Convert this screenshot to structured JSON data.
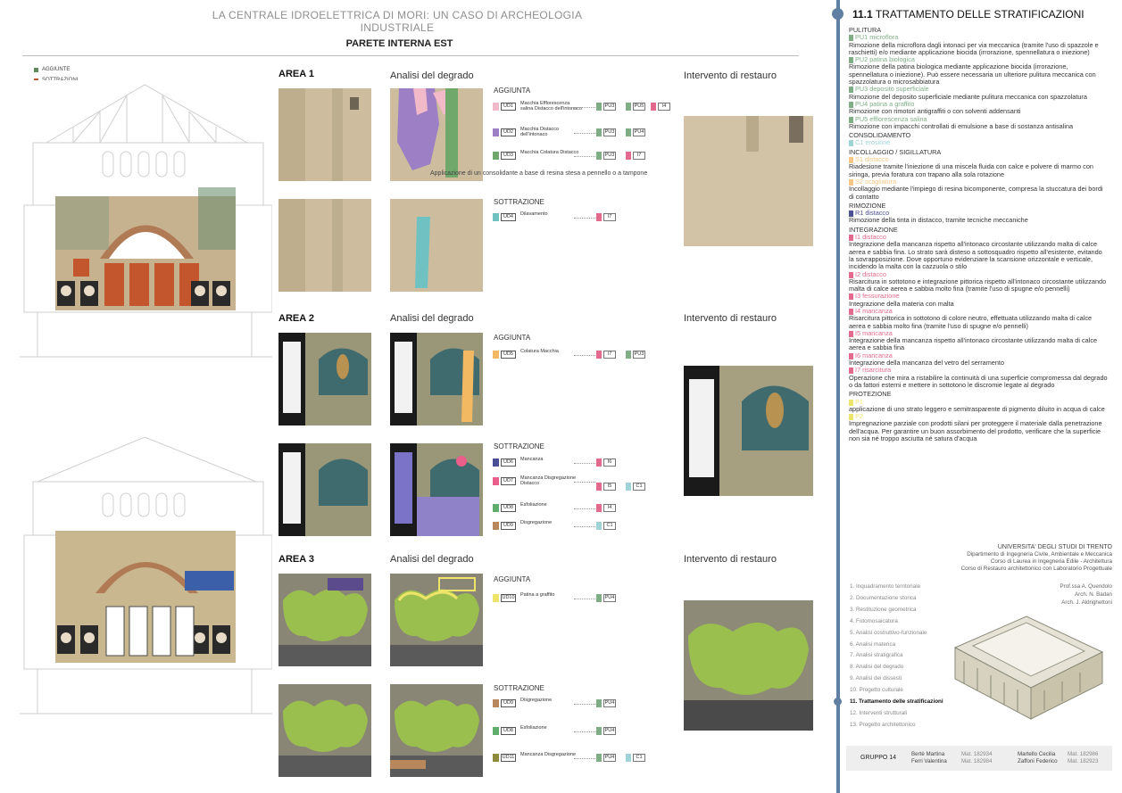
{
  "page": {
    "title": "LA CENTRALE IDROELETTRICA DI MORI: UN CASO DI ARCHEOLOGIA INDUSTRIALE",
    "subtitle": "PARETE INTERNA EST"
  },
  "legend": [
    {
      "label": "AGGIUNTE",
      "color": "#5f8a5c"
    },
    {
      "label": "SOTTRAZIONI",
      "color": "#c4562e"
    }
  ],
  "columns": {
    "degrado": "Analisi del degrado",
    "restauro": "Intervento di restauro"
  },
  "areas": [
    {
      "label": "AREA 1",
      "aggiunta_title": "AGGIUNTA",
      "aggiunta": [
        {
          "code": "UD1",
          "desc": "Macchia Efflorescenza salina Distacco dell'intonaco",
          "color": "#f2b9c8",
          "tags": [
            {
              "t": "PU3",
              "c": "#7fae86"
            },
            {
              "t": "PU5",
              "c": "#7fae86"
            },
            {
              "t": "I4",
              "c": "#e36a8c"
            }
          ]
        },
        {
          "code": "UD2",
          "desc": "Macchia Distacco dell'intonaco",
          "color": "#9c7fc5",
          "tags": [
            {
              "t": "PU3",
              "c": "#7fae86"
            },
            {
              "t": "PU4",
              "c": "#7fae86"
            }
          ]
        },
        {
          "code": "UD3",
          "desc": "Macchia Colatura Distacco",
          "color": "#6fa86a",
          "tags": [
            {
              "t": "PU3",
              "c": "#7fae86"
            },
            {
              "t": "I7",
              "c": "#e36a8c"
            }
          ]
        }
      ],
      "note": "Applicazione di un consolidante a base di resina stesa a pennello o a tampone",
      "sottrazione_title": "SOTTRAZIONE",
      "sottrazione": [
        {
          "code": "UD4",
          "desc": "Dilavamento",
          "color": "#6fc1c2",
          "tags": [
            {
              "t": "I7",
              "c": "#e36a8c"
            }
          ]
        }
      ]
    },
    {
      "label": "AREA 2",
      "aggiunta_title": "AGGIUNTA",
      "aggiunta": [
        {
          "code": "UD5",
          "desc": "Colatura Macchia",
          "color": "#f2b862",
          "tags": [
            {
              "t": "I7",
              "c": "#e36a8c"
            },
            {
              "t": "PU3",
              "c": "#7fae86"
            }
          ]
        }
      ],
      "sottrazione_title": "SOTTRAZIONE",
      "sottrazione": [
        {
          "code": "UD6",
          "desc": "Mancanza",
          "color": "#4b4f96",
          "tags": [
            {
              "t": "I6",
              "c": "#e36a8c"
            }
          ]
        },
        {
          "code": "UD7",
          "desc": "Mancanza Disgregazione Distacco",
          "color": "#ea5e8a",
          "tags": [
            {
              "t": "I5",
              "c": "#e36a8c"
            },
            {
              "t": "C1",
              "c": "#9fd3d6"
            }
          ]
        },
        {
          "code": "UD8",
          "desc": "Esfoliazione",
          "color": "#5fae6b",
          "tags": [
            {
              "t": "I4",
              "c": "#e36a8c"
            }
          ]
        },
        {
          "code": "UD9",
          "desc": "Disgregazione",
          "color": "#b8875c",
          "tags": [
            {
              "t": "C1",
              "c": "#9fd3d6"
            }
          ]
        }
      ]
    },
    {
      "label": "AREA 3",
      "aggiunta_title": "AGGIUNTA",
      "aggiunta": [
        {
          "code": "UD10",
          "desc": "Patina a graffito",
          "color": "#efe46a",
          "tags": [
            {
              "t": "PU4",
              "c": "#7fae86"
            }
          ]
        }
      ],
      "sottrazione_title": "SOTTRAZIONE",
      "sottrazione": [
        {
          "code": "UD9",
          "desc": "Disgregazione",
          "color": "#b8875c",
          "tags": [
            {
              "t": "PU4",
              "c": "#7fae86"
            }
          ]
        },
        {
          "code": "UD8",
          "desc": "Esfoliazione",
          "color": "#5fae6b",
          "tags": [
            {
              "t": "PU4",
              "c": "#7fae86"
            }
          ]
        },
        {
          "code": "UD11",
          "desc": "Mancanza Disgregazione",
          "color": "#8d8a3c",
          "tags": [
            {
              "t": "PU4",
              "c": "#7fae86"
            },
            {
              "t": "C1",
              "c": "#9fd3d6"
            }
          ]
        }
      ]
    }
  ],
  "panel": {
    "number": "11.1",
    "title": "TRATTAMENTO DELLE STRATIFICAZIONI",
    "sections": [
      {
        "name": "PULITURA",
        "items": [
          {
            "label": "PU1 microflora",
            "color": "#7fae86",
            "desc": "Rimozione della microflora dagli intonaci per via meccanica (tramite l'uso di spazzole e raschietti) e/o mediante applicazione biocida (irrorazione, spennellatura o iniezione)"
          },
          {
            "label": "PU2 patina biologica",
            "color": "#7fae86",
            "desc": "Rimozione della patina biologica mediante applicazione biocida (irrorazione, spennellatura o iniezione). Può essere necessaria un ulteriore pulitura meccanica con spazzolatura o microsabbiatura"
          },
          {
            "label": "PU3 deposito superficiale",
            "color": "#7fae86",
            "desc": "Rimozione del deposito superficiale mediante pulitura meccanica con spazzolatura"
          },
          {
            "label": "PU4 patina a graffito",
            "color": "#7fae86",
            "desc": "Rimozione con rimotori antigraffiti o con solventi addensanti"
          },
          {
            "label": "PU5 efflorescenza salina",
            "color": "#7fae86",
            "desc": "Rimozione con impacchi controllati di emulsione a base di sostanza antisalina"
          }
        ]
      },
      {
        "name": "CONSOLIDAMENTO",
        "items": [
          {
            "label": "C1 erosione",
            "color": "#9fd3d6",
            "desc": ""
          }
        ]
      },
      {
        "name": "INCOLLAGGIO / SIGILLATURA",
        "items": [
          {
            "label": "S1 distacco",
            "color": "#f4c784",
            "desc": "Riadesione tramite l'iniezione di una miscela fluida con calce e polvere di marmo con siringa, previa foratura con trapano alla sola rotazione"
          },
          {
            "label": "S2 scagliatura",
            "color": "#f4c784",
            "desc": "Incollaggio mediante l'impiego di resina bicomponente, compresa la stuccatura dei bordi di contatto"
          }
        ]
      },
      {
        "name": "RIMOZIONE",
        "items": [
          {
            "label": "R1 distacco",
            "color": "#4b4f96",
            "desc": "Rimozione della tinta in distacco, tramite tecniche meccaniche"
          }
        ]
      },
      {
        "name": "INTEGRAZIONE",
        "items": [
          {
            "label": "I1 distacco",
            "color": "#e36a8c",
            "desc": "Integrazione della mancanza rispetto all'intonaco circostante utilizzando malta di calce aerea e sabbia fina. Lo strato sarà disteso a sottosquadro rispetto all'esistente, evitando la sovrapposizione. Dove opportuno evidenziare la scansione orizzontale e verticale, incidendo la malta con la cazzuola o stilo"
          },
          {
            "label": "I2 distacco",
            "color": "#e36a8c",
            "desc": "Risarcitura in sottotono e integrazione pittorica rispetto all'intonaco circostante utilizzando malta di calce aerea e sabbia molto fina (tramite l'uso di spugne e/o pennelli)"
          },
          {
            "label": "I3 fessurazione",
            "color": "#e36a8c",
            "desc": "Integrazione della materia con malta"
          },
          {
            "label": "I4 mancanza",
            "color": "#e36a8c",
            "desc": "Risarcitura pittorica in sottotono di colore neutro, effettuata utilizzando malta di calce aerea e sabbia molto fina (tramite l'uso di spugne e/o pennelli)"
          },
          {
            "label": "I5 mancanza",
            "color": "#e36a8c",
            "desc": "Integrazione della mancanza rispetto all'intonaco circostante utilizzando malta di calce aerea e sabbia fina"
          },
          {
            "label": "I6 mancanza",
            "color": "#e36a8c",
            "desc": "Integrazione della mancanza del vetro del serramento"
          },
          {
            "label": "I7 risarcitura",
            "color": "#e36a8c",
            "desc": "Operazione che mira a ristabilire la continuità di una superficie compromessa dal degrado o da fattori esterni e mettere in sottotono le discromie legate al degrado"
          }
        ]
      },
      {
        "name": "PROTEZIONE",
        "items": [
          {
            "label": "P1",
            "color": "#efe46a",
            "desc": "applicazione di uno strato leggero e semitrasparente di pigmento diluito in acqua di calce"
          },
          {
            "label": "P2",
            "color": "#efe46a",
            "desc": "Impregnazione parziale con prodotti silani per proteggere il materiale dalla penetrazione dell'acqua. Per garantire un buon assorbimento del prodotto, verificare che la superficie non sia né troppo asciutta né satura d'acqua"
          }
        ]
      }
    ]
  },
  "university": {
    "name": "UNIVERSITA' DEGLI STUDI DI TRENTO",
    "lines": [
      "Dipartimento di Ingegneria Civile, Ambientale e Meccanica",
      "Corso di Laurea in Ingegneria Edile - Architettura",
      "Corso di Restauro architettonico con Laboratorio Progettuale"
    ],
    "profs": [
      "Prof.ssa A. Quendolo",
      "Arch. N. Badan",
      "Arch. J. Aldrighettoni"
    ]
  },
  "toc": [
    "1. Inquadramento territoriale",
    "2. Documentazione storica",
    "3. Restituzione geometrica",
    "4. Fotomosaicatura",
    "5. Analisi costruttivo-funzionale",
    "6. Analisi materica",
    "7. Analisi stratigrafica",
    "8. Analisi del degrado",
    "9. Analisi dei dissesti",
    "10. Progetto culturale",
    "11. Trattamento delle stratificazioni",
    "12. Interventi strutturali",
    "13. Progetto architettonico"
  ],
  "toc_current_index": 10,
  "group": {
    "name": "GRUPPO 14",
    "members": [
      {
        "name": "Bertè Martina",
        "mat": "Mat. 182934"
      },
      {
        "name": "Ferri Valentina",
        "mat": "Mat. 182984"
      },
      {
        "name": "Martello Cecilia",
        "mat": "Mat. 182986"
      },
      {
        "name": "Zaffoni Federico",
        "mat": "Mat. 182923"
      }
    ]
  },
  "colors": {
    "accent": "#5f7fa3",
    "plaster": "#cdbd9e",
    "graffiti": "#9bbf4e"
  }
}
